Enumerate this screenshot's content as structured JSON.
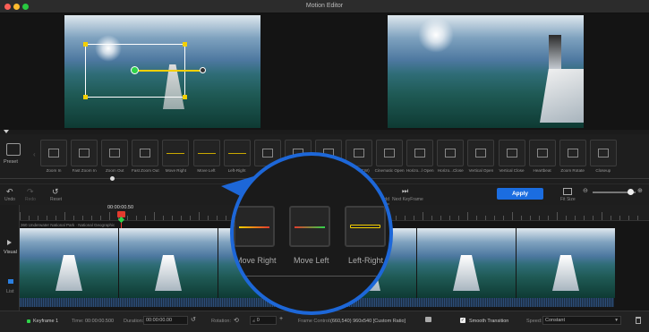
{
  "window": {
    "title": "Motion Editor"
  },
  "effects": [
    {
      "id": "zoom-in",
      "label": "Zoom In"
    },
    {
      "id": "fast-zoom-in",
      "label": "Fast Zoom In"
    },
    {
      "id": "zoom-out",
      "label": "Zoom Out"
    },
    {
      "id": "fast-zoom-out",
      "label": "Fast Zoom Out"
    },
    {
      "id": "move-right",
      "label": "Move Right"
    },
    {
      "id": "move-left",
      "label": "Move Left"
    },
    {
      "id": "left-right",
      "label": "Left-Right"
    },
    {
      "id": "hidden-1",
      "label": ""
    },
    {
      "id": "hidden-2",
      "label": ""
    },
    {
      "id": "roll-cw",
      "label": "CW)"
    },
    {
      "id": "roll-ccw",
      "label": "Roll (CCW)"
    },
    {
      "id": "cinematic-open",
      "label": "Cinematic Open"
    },
    {
      "id": "horizontal-open",
      "label": "Horizo...l Open"
    },
    {
      "id": "horizontal-close",
      "label": "Horizo...Close"
    },
    {
      "id": "vertical-open",
      "label": "Vertical Open"
    },
    {
      "id": "vertical-close",
      "label": "Vertical Close"
    },
    {
      "id": "heartbeat",
      "label": "Heartbeat"
    },
    {
      "id": "zoom-rotate",
      "label": "Zoom Rotate"
    },
    {
      "id": "closeup",
      "label": "Closeup"
    }
  ],
  "preset": {
    "label": "Preset"
  },
  "toolbar": {
    "undo": "Undo",
    "redo": "Redo",
    "reset": "Reset",
    "add_keyframe": "Add KeyFrame",
    "next_keyframe": "Next KeyFrame",
    "apply": "Apply",
    "fit_size": "Fit Size"
  },
  "magnifier": {
    "labels": [
      "Move Right",
      "Move Left",
      "Left-Right"
    ]
  },
  "timeline": {
    "playhead_time": "00:00:00.50",
    "clip_title": "360 Underwater National Park · National Geographic",
    "visual_tab": "Visual",
    "list_tab": "List"
  },
  "bottom": {
    "keyframe_label": "Keyframe 1",
    "time_label": "Time:",
    "time_value": "00:00:00.500",
    "duration_label": "Duration:",
    "duration_value": "00:00:00.00",
    "rotation_label": "Rotation:",
    "rotation_value": "0",
    "frame_control_label": "Frame Control:",
    "frame_control_value": "(660,540)  960x540  [Custom Ratio]",
    "smooth_label": "Smooth Transition",
    "smooth_checked": true,
    "speed_label": "Speed:",
    "speed_value": "Constant"
  }
}
